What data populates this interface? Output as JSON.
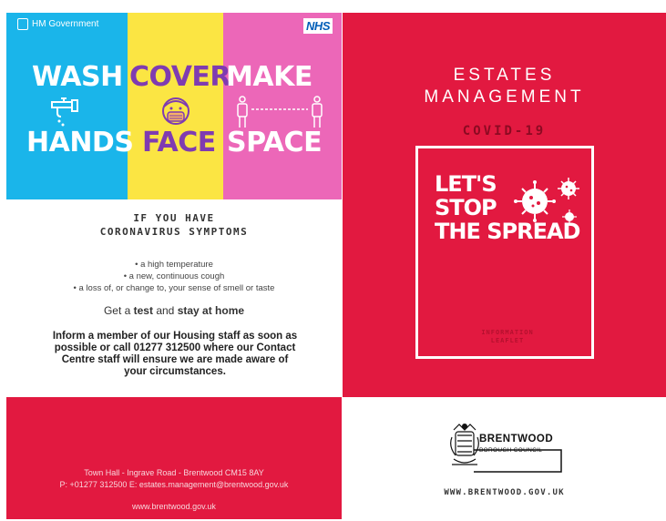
{
  "left_panel": {
    "header": {
      "gov_label": "HM Government",
      "nhs_label": "NHS"
    },
    "banner": {
      "wash": "WASH",
      "hands": "HANDS",
      "cover": "COVER",
      "face": "FACE",
      "make": "MAKE",
      "space": "SPACE"
    },
    "symptoms_title_1": "IF YOU HAVE",
    "symptoms_title_2": "CORONAVIRUS SYMPTOMS",
    "symptoms": [
      "• a high temperature",
      "• a new, continuous cough",
      "• a loss of, or change to, your sense of smell or taste"
    ],
    "get_test": {
      "pre": "Get a ",
      "test": "test",
      "mid": " and ",
      "stay": "stay at home"
    },
    "inform_text": "Inform a member of our Housing staff as soon as possible or call 01277 312500 where our Contact Centre staff will ensure we are made aware of your circumstances.",
    "footer": {
      "address": "Town Hall - Ingrave Road - Brentwood CM15 8AY",
      "contact": "P: +01277 312500 E: estates.management@brentwood.gov.uk",
      "website": "www.brentwood.gov.uk"
    }
  },
  "right_panel": {
    "title_1": "ESTATES",
    "title_2": "MANAGEMENT",
    "covid": "COVID-19",
    "stop_lines": [
      "LET'S",
      "STOP",
      "THE SPREAD"
    ],
    "info_1": "INFORMATION",
    "info_2": "LEAFLET",
    "logo_name": "BRENTWOOD",
    "logo_sub": "BOROUGH COUNCIL",
    "website": "WWW.BRENTWOOD.GOV.UK"
  },
  "colors": {
    "red": "#e21940",
    "blue": "#1ab5ea",
    "yellow": "#fbe543",
    "pink": "#ec67b8",
    "purple": "#7f3bb1"
  }
}
